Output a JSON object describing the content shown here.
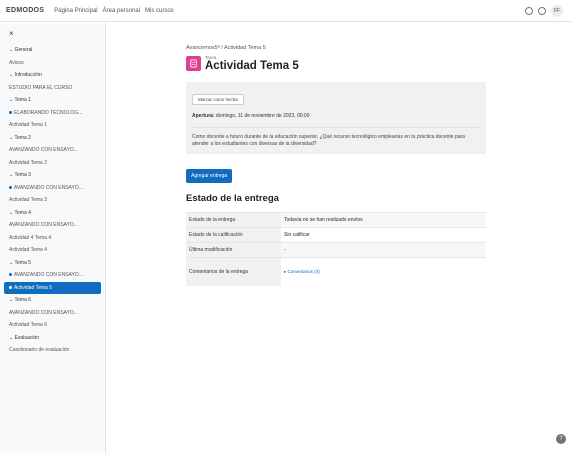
{
  "navbar": {
    "brand": "EDMODOS",
    "links": [
      "Página Principal",
      "Área personal",
      "Mis cursos"
    ],
    "avatar": "FF"
  },
  "sidebar": {
    "close_label": "×",
    "items": [
      {
        "label": "General",
        "type": "section"
      },
      {
        "label": "Avisos",
        "type": "item"
      },
      {
        "label": "Introducción",
        "type": "section"
      },
      {
        "label": "ESTUDIO PARA EL CURSO",
        "type": "item"
      },
      {
        "label": "Tema 1",
        "type": "section"
      },
      {
        "label": "ELABORANDO TECNOLOG...",
        "type": "dot"
      },
      {
        "label": "Actividad Tema 1",
        "type": "item"
      },
      {
        "label": "Tema 2",
        "type": "section"
      },
      {
        "label": "AVANZANDO CON ENSAYO...",
        "type": "item"
      },
      {
        "label": "Actividad Tema 2",
        "type": "item"
      },
      {
        "label": "Tema 3",
        "type": "section"
      },
      {
        "label": "AVANZANDO CON ENSAYO...",
        "type": "dot"
      },
      {
        "label": "Actividad Tema 3",
        "type": "item"
      },
      {
        "label": "Tema 4",
        "type": "section"
      },
      {
        "label": "AVANZANDO CON ENSAYO...",
        "type": "item"
      },
      {
        "label": "Actividad 4 Tema 4",
        "type": "item"
      },
      {
        "label": "Actividad Tema 4",
        "type": "item"
      },
      {
        "label": "Tema 5",
        "type": "section"
      },
      {
        "label": "AVANZANDO CON ENSAYO...",
        "type": "dot"
      },
      {
        "label": "Actividad Tema 5",
        "type": "active"
      },
      {
        "label": "Tema 6",
        "type": "section"
      },
      {
        "label": "AVANZANDO CON ENSAYO...",
        "type": "item"
      },
      {
        "label": "Actividad Tema 6",
        "type": "item"
      },
      {
        "label": "Evaluación",
        "type": "section"
      },
      {
        "label": "Cuestionario de evaluación",
        "type": "item"
      }
    ]
  },
  "main": {
    "breadcrumb": "Avancemos5º / Actividad Tema 5",
    "kind": "Tarea",
    "title": "Actividad Tema 5",
    "done_button": "Marcar como hecha",
    "dates_label": "Apertura:",
    "dates_value": "domingo, 11 de noviembre de 2023, 00:00",
    "description": "Como docente a futuro durante de la educación superior, ¿Qué recurso tecnológico emplearías en tu práctica docente para atender a los estudiantes con diversas de la diversidad?",
    "submit_button": "Agregar entrega",
    "status_heading": "Estado de la entrega",
    "status_rows": [
      {
        "label": "Estado de la entrega",
        "value": "Todavía no se han realizado envíos"
      },
      {
        "label": "Estado de la calificación",
        "value": "Sin calificar"
      },
      {
        "label": "Última modificación",
        "value": "-"
      },
      {
        "label": "Comentarios de la entrega",
        "value": "▸ Comentarios (0)"
      }
    ]
  },
  "help_label": "?"
}
